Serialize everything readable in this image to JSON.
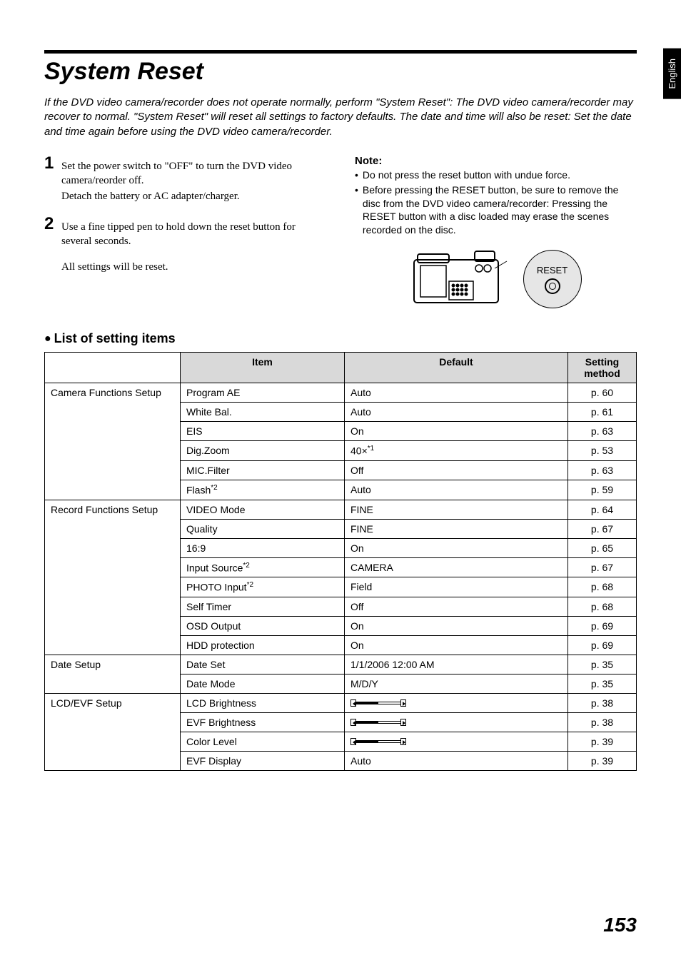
{
  "side_tab": "English",
  "title": "System Reset",
  "intro": "If the DVD video camera/recorder does not operate normally, perform \"System Reset\": The DVD video camera/recorder may recover to normal. \"System Reset\" will reset all settings to factory defaults. The date and time will also be reset: Set the date and time again before using the DVD video camera/recorder.",
  "steps": [
    {
      "num": "1",
      "lines": [
        "Set the power switch to \"OFF\" to turn the DVD video camera/reorder off.",
        "Detach the battery or AC adapter/charger."
      ]
    },
    {
      "num": "2",
      "lines": [
        "Use a fine tipped pen to hold down the reset button for several seconds."
      ]
    }
  ],
  "after_steps": "All settings will be reset.",
  "note": {
    "heading": "Note:",
    "items": [
      "Do not press the reset button with undue force.",
      "Before pressing the RESET button, be sure to remove the disc from the DVD video camera/recorder: Pressing the RESET button with a disc loaded may erase the scenes recorded on the disc."
    ]
  },
  "reset_label": "RESET",
  "settings_heading": "List of setting items",
  "table": {
    "headers": {
      "cat": "",
      "item": "Item",
      "default": "Default",
      "method": "Setting method"
    },
    "groups": [
      {
        "category": "Camera Functions Setup",
        "rows": [
          {
            "item": "Program AE",
            "default": "Auto",
            "method": "p. 60"
          },
          {
            "item": "White Bal.",
            "default": "Auto",
            "method": "p. 61"
          },
          {
            "item": "EIS",
            "default": "On",
            "method": "p. 63"
          },
          {
            "item": "Dig.Zoom",
            "default_html": "40×<span class='sup'>*1</span>",
            "method": "p. 53"
          },
          {
            "item": "MIC.Filter",
            "default": "Off",
            "method": "p. 63"
          },
          {
            "item_html": "Flash<span class='sup'>*2</span>",
            "default": "Auto",
            "method": "p. 59"
          }
        ]
      },
      {
        "category": "Record Functions Setup",
        "rows": [
          {
            "item": "VIDEO Mode",
            "default": "FINE",
            "method": "p. 64"
          },
          {
            "item": "Quality",
            "default": "FINE",
            "method": "p. 67"
          },
          {
            "item": "16:9",
            "default": "On",
            "method": "p. 65"
          },
          {
            "item_html": "Input Source<span class='sup'>*2</span>",
            "default": "CAMERA",
            "method": "p. 67"
          },
          {
            "item_html": "PHOTO Input<span class='sup'>*2</span>",
            "default": "Field",
            "method": "p. 68"
          },
          {
            "item": "Self Timer",
            "default": "Off",
            "method": "p. 68"
          },
          {
            "item": "OSD Output",
            "default": "On",
            "method": "p. 69"
          },
          {
            "item": "HDD protection",
            "default": "On",
            "method": "p. 69"
          }
        ]
      },
      {
        "category": "Date Setup",
        "rows": [
          {
            "item": "Date Set",
            "default": "1/1/2006 12:00 AM",
            "method": "p. 35"
          },
          {
            "item": "Date Mode",
            "default": "M/D/Y",
            "method": "p. 35"
          }
        ]
      },
      {
        "category": "LCD/EVF Setup",
        "rows": [
          {
            "item": "LCD Brightness",
            "default_slider": 50,
            "method": "p. 38"
          },
          {
            "item": "EVF Brightness",
            "default_slider": 50,
            "method": "p. 38"
          },
          {
            "item": "Color Level",
            "default_slider": 50,
            "method": "p. 39"
          },
          {
            "item": "EVF Display",
            "default": "Auto",
            "method": "p. 39"
          }
        ]
      }
    ]
  },
  "page_number": "153"
}
